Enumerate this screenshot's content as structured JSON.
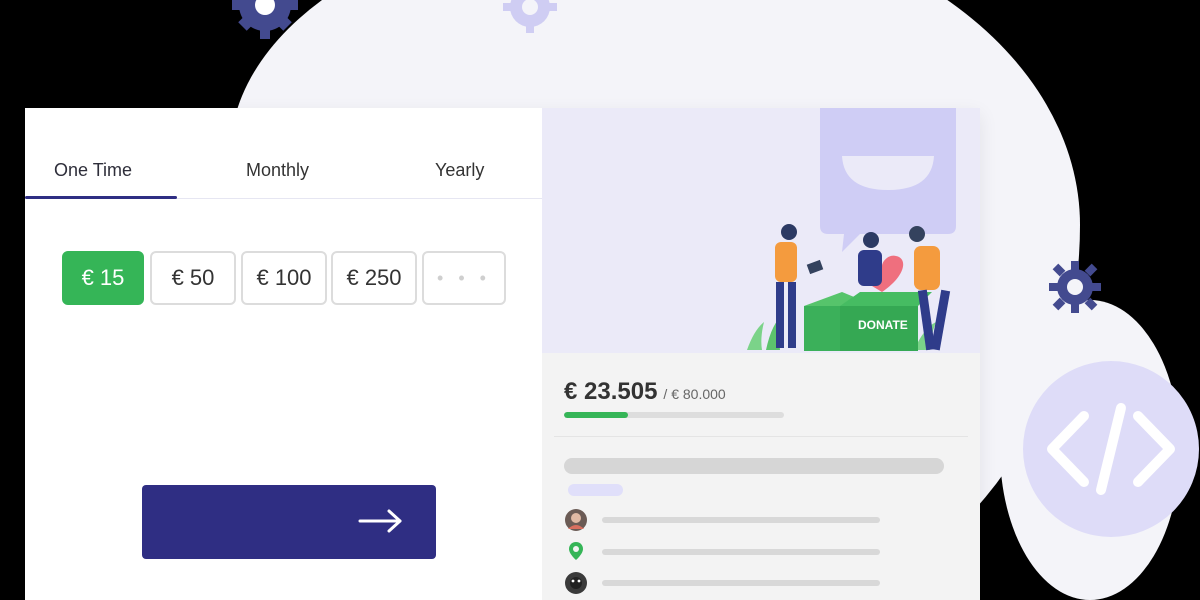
{
  "tabs": {
    "active_index": 0,
    "items": [
      {
        "label": "One Time"
      },
      {
        "label": "Monthly"
      },
      {
        "label": "Yearly"
      }
    ]
  },
  "amounts": {
    "selected_index": 0,
    "items": [
      {
        "label": "€ 15"
      },
      {
        "label": "€ 50"
      },
      {
        "label": "€ 100"
      },
      {
        "label": "€ 250"
      },
      {
        "label": "• • •"
      }
    ]
  },
  "campaign": {
    "raised": "€ 23.505",
    "goal": "/ € 80.000",
    "progress_fraction": 0.29,
    "illustration_box_label": "DONATE"
  },
  "icons": {
    "next": "arrow-right-icon",
    "code": "code-icon",
    "gear": "gear-icon",
    "location": "location-pin-icon",
    "avatar": "avatar-icon"
  },
  "colors": {
    "accent": "#2f2e83",
    "success": "#35b557",
    "lavender": "#e0dffa"
  }
}
